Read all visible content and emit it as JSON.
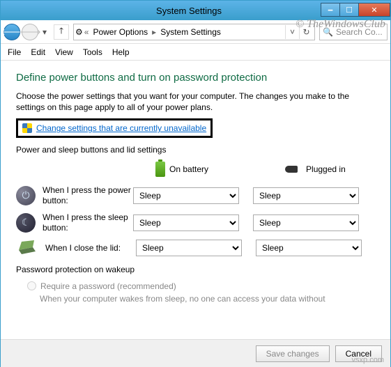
{
  "window": {
    "title": "System Settings"
  },
  "nav": {
    "crumb1": "Power Options",
    "crumb2": "System Settings",
    "search_placeholder": "Search Co..."
  },
  "menu": {
    "file": "File",
    "edit": "Edit",
    "view": "View",
    "tools": "Tools",
    "help": "Help"
  },
  "watermark": "© TheWindowsClub",
  "page": {
    "heading": "Define power buttons and turn on password protection",
    "description": "Choose the power settings that you want for your computer. The changes you make to the settings on this page apply to all of your power plans.",
    "admin_link": "Change settings that are currently unavailable",
    "section_buttons": "Power and sleep buttons and lid settings",
    "col_battery": "On battery",
    "col_plugged": "Plugged in",
    "rows": {
      "power": {
        "label": "When I press the power button:",
        "battery": "Sleep",
        "plugged": "Sleep"
      },
      "sleep": {
        "label": "When I press the sleep button:",
        "battery": "Sleep",
        "plugged": "Sleep"
      },
      "lid": {
        "label": "When I close the lid:",
        "battery": "Sleep",
        "plugged": "Sleep"
      }
    },
    "section_wakeup": "Password protection on wakeup",
    "radio_label": "Require a password (recommended)",
    "wakeup_desc": "When your computer wakes from sleep, no one can access your data without"
  },
  "footer": {
    "save": "Save changes",
    "cancel": "Cancel"
  },
  "source_url": "vsxp.com"
}
